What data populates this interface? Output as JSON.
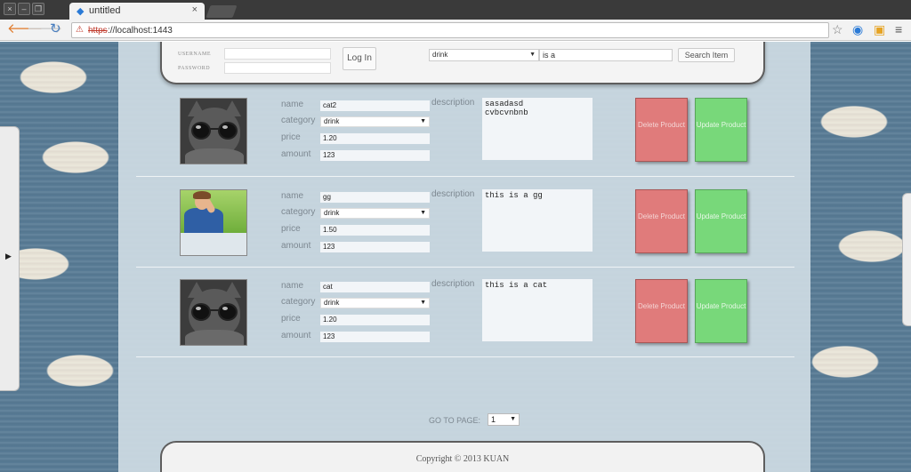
{
  "browser": {
    "tab_title": "untitled",
    "tab_close": "×",
    "url_scheme": "https",
    "url": "://localhost:1443",
    "window_buttons": [
      "×",
      "–",
      "❐"
    ]
  },
  "icons": {
    "back": "arrow-left-icon",
    "forward": "arrow-right-icon",
    "reload": "reload-icon",
    "star": "star-icon",
    "menu": "hamburger-menu-icon"
  },
  "login": {
    "username_label": "USERNAME",
    "password_label": "PASSWORD",
    "login_button": "Log In"
  },
  "search": {
    "category": "drink",
    "query": "is a",
    "button": "Search Item"
  },
  "labels": {
    "name": "name",
    "category": "category",
    "price": "price",
    "amount": "amount",
    "description": "description",
    "delete": "Delete Product",
    "update": "Update Product"
  },
  "products": [
    {
      "name": "cat2",
      "category": "drink",
      "price": "1.20",
      "amount": "123",
      "description": "sasadasd\ncvbcvnbnb",
      "image": "cat-with-sunglasses"
    },
    {
      "name": "gg",
      "category": "drink",
      "price": "1.50",
      "amount": "123",
      "description": "this is a gg",
      "image": "person-outdoors"
    },
    {
      "name": "cat",
      "category": "drink",
      "price": "1.20",
      "amount": "123",
      "description": "this is a cat",
      "image": "cat-with-sunglasses"
    }
  ],
  "pagination": {
    "label": "GO TO PAGE:",
    "current_page": "1"
  },
  "footer": {
    "copyright": "Copyright © 2013 KUAN"
  },
  "colors": {
    "delete": "#e07b7b",
    "update": "#78d87a",
    "background": "#587b95"
  }
}
